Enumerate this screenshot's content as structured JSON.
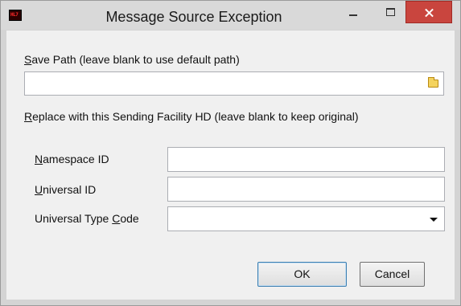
{
  "window": {
    "title": "Message Source Exception",
    "app_icon_text": "HL7"
  },
  "save_path": {
    "label_accel": "S",
    "label_rest": "ave Path (leave blank to use default path)",
    "value": ""
  },
  "replace_section": {
    "label_accel": "R",
    "label_rest": "eplace with this Sending Facility HD (leave blank to keep original)"
  },
  "fields": {
    "namespace_id": {
      "label_accel": "N",
      "label_rest": "amespace ID",
      "value": ""
    },
    "universal_id": {
      "label_accel": "U",
      "label_rest": "niversal ID",
      "value": ""
    },
    "universal_type_code": {
      "label_pre": "Universal Type ",
      "label_accel": "C",
      "label_rest": "ode",
      "value": ""
    }
  },
  "buttons": {
    "ok": "OK",
    "cancel": "Cancel"
  },
  "icons": {
    "app": "hl7-app-icon",
    "minimize": "minimize-icon",
    "maximize": "maximize-icon",
    "close": "close-icon",
    "browse": "folder-icon",
    "dropdown": "chevron-down-icon"
  },
  "colors": {
    "close_button": "#c9453e",
    "dialog_background": "#f0f0f0"
  }
}
